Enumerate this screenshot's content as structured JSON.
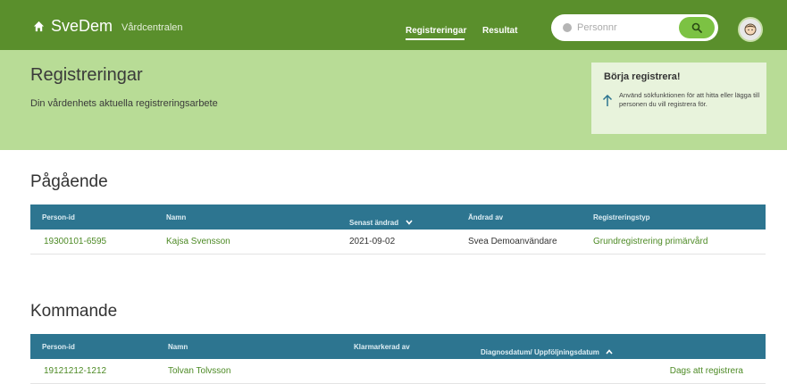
{
  "brand": {
    "name": "SveDem",
    "unit": "Vårdcentralen",
    "home_icon": "home-icon"
  },
  "nav": {
    "registreringar": "Registreringar",
    "resultat": "Resultat"
  },
  "search": {
    "placeholder": "Personnr",
    "info_icon": "info-icon",
    "button_icon": "search-icon"
  },
  "user": {
    "avatar_icon": "user-avatar-icon"
  },
  "hero": {
    "title": "Registreringar",
    "subtitle": "Din vårdenhets aktuella registreringsarbete",
    "tip_title": "Börja registrera!",
    "tip_text": "Använd sökfunktionen för att hitta eller lägga till personen du vill registrera för."
  },
  "pagaende": {
    "title": "Pågående",
    "columns": [
      "Person-id",
      "Namn",
      "Senast ändrad",
      "Ändrad av",
      "Registreringstyp"
    ],
    "sort_indicator": "chevron-down",
    "rows": [
      {
        "person_id": "19300101-6595",
        "namn": "Kajsa Svensson",
        "senast_andrad": "2021-09-02",
        "andrad_av": "Svea Demoanvändare",
        "typ": "Grundregistrering primärvård"
      }
    ]
  },
  "kommande": {
    "title": "Kommande",
    "columns": [
      "Person-id",
      "Namn",
      "Klarmarkerad av",
      "Diagnosdatum/ Uppföljningsdatum"
    ],
    "sort_indicator": "chevron-up",
    "rows": [
      {
        "person_id": "19121212-1212",
        "namn": "Tolvan Tolvsson",
        "klarmarkerad_av": "",
        "status": "Dags att registrera"
      }
    ]
  },
  "colors": {
    "nav": "#5a8f2c",
    "hero": "#b8dc96",
    "table_header": "#2d7590",
    "link": "#4d8a25",
    "search_button": "#7cc243"
  }
}
